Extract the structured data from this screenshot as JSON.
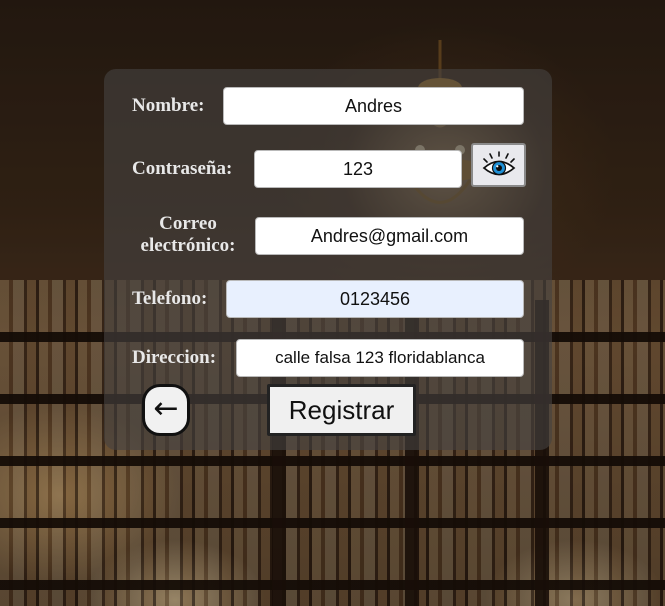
{
  "form": {
    "nombre": {
      "label": "Nombre:",
      "value": "Andres"
    },
    "contrasena": {
      "label": "Contraseña:",
      "value": "123"
    },
    "correo": {
      "label_line1": "Correo",
      "label_line2": "electrónico:",
      "value": "Andres@gmail.com"
    },
    "telefono": {
      "label": "Telefono:",
      "value": "0123456"
    },
    "direccion": {
      "label": "Direccion:",
      "value": "calle falsa 123 floridablanca"
    },
    "show_password_icon": "eye-icon",
    "back_button": {
      "label": "←",
      "icon": "left-arrow-icon"
    },
    "submit_button": {
      "label": "Registrar"
    }
  },
  "colors": {
    "panel": "#46424080",
    "label_text": "#e8e8e8",
    "autofill_field": "#e8f0fe",
    "eye_iris": "#1e90d6"
  }
}
